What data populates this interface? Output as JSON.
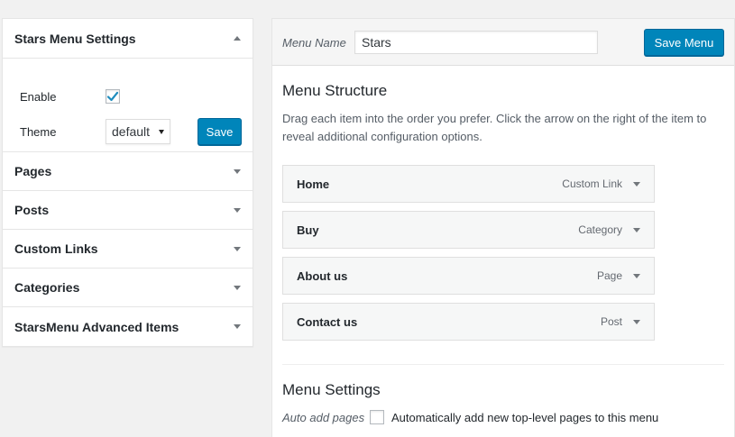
{
  "left_panel": {
    "stars_settings": {
      "title": "Stars Menu Settings",
      "enable_label": "Enable",
      "enable_checked": true,
      "theme_label": "Theme",
      "theme_value": "default",
      "save_label": "Save"
    },
    "sections": [
      {
        "label": "Pages"
      },
      {
        "label": "Posts"
      },
      {
        "label": "Custom Links"
      },
      {
        "label": "Categories"
      },
      {
        "label": "StarsMenu Advanced Items"
      }
    ]
  },
  "menu_header": {
    "name_label": "Menu Name",
    "name_value": "Stars",
    "save_menu_label": "Save Menu"
  },
  "menu_structure": {
    "title": "Menu Structure",
    "description": "Drag each item into the order you prefer. Click the arrow on the right of the item to reveal additional configuration options.",
    "items": [
      {
        "title": "Home",
        "type": "Custom Link"
      },
      {
        "title": "Buy",
        "type": "Category"
      },
      {
        "title": "About us",
        "type": "Page"
      },
      {
        "title": "Contact us",
        "type": "Post"
      }
    ]
  },
  "menu_settings": {
    "title": "Menu Settings",
    "auto_add_label": "Auto add pages",
    "auto_add_text": "Automatically add new top-level pages to this menu"
  },
  "colors": {
    "primary_button": "#0085ba",
    "checkbox_check": "#1e8cbe"
  }
}
